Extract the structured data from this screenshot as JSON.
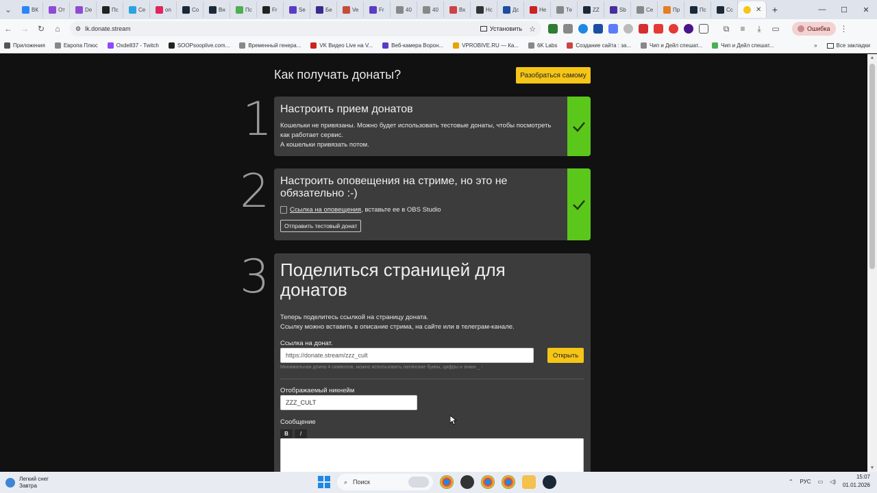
{
  "browser": {
    "tabs": [
      {
        "label": "ВК",
        "color": "#2787f5"
      },
      {
        "label": "От",
        "color": "#8e4bd6"
      },
      {
        "label": "De",
        "color": "#8e4bd6"
      },
      {
        "label": "Пс",
        "color": "#222222"
      },
      {
        "label": "Се",
        "color": "#2aa3df"
      },
      {
        "label": "on",
        "color": "#e0245e"
      },
      {
        "label": "Со",
        "color": "#1b2838"
      },
      {
        "label": "Вн",
        "color": "#1b2838"
      },
      {
        "label": "Пс",
        "color": "#4caf50"
      },
      {
        "label": "Fr",
        "color": "#222222"
      },
      {
        "label": "Se",
        "color": "#5b3cc4"
      },
      {
        "label": "Бе",
        "color": "#3b2b8f"
      },
      {
        "label": "Ve",
        "color": "#c74b3b"
      },
      {
        "label": "Fr",
        "color": "#5b3cc4"
      },
      {
        "label": "40",
        "color": "#888888"
      },
      {
        "label": "40",
        "color": "#888888"
      },
      {
        "label": "Вх",
        "color": "#c44"
      },
      {
        "label": "Нс",
        "color": "#333333"
      },
      {
        "label": "Дс",
        "color": "#1c4ea2"
      },
      {
        "label": "Не",
        "color": "#c22"
      },
      {
        "label": "Те",
        "color": "#888888"
      },
      {
        "label": "ZZ",
        "color": "#1b2838"
      },
      {
        "label": "Sb",
        "color": "#4a2e9e"
      },
      {
        "label": "Се",
        "color": "#888888"
      },
      {
        "label": "Пр",
        "color": "#e67e22"
      },
      {
        "label": "Пс",
        "color": "#1b2838"
      },
      {
        "label": "Сс",
        "color": "#1b2838"
      }
    ],
    "active_tab_color": "#f5c518",
    "url": "lk.donate.stream",
    "install_label": "Установить",
    "error_label": "Ошибка",
    "bookmarks": [
      {
        "label": "Приложения",
        "color": "#555"
      },
      {
        "label": "Европа Плюс",
        "color": "#888"
      },
      {
        "label": "Oxde837 - Twitch",
        "color": "#9146ff"
      },
      {
        "label": "SOOPsooplive.com...",
        "color": "#222"
      },
      {
        "label": "Временный генера...",
        "color": "#888"
      },
      {
        "label": "VK Видео Live на V...",
        "color": "#c22"
      },
      {
        "label": "Веб-камера Ворон...",
        "color": "#5b3cc4"
      },
      {
        "label": "VPROBIVE.RU — Ка...",
        "color": "#e6a400"
      },
      {
        "label": "6K Labs",
        "color": "#888"
      },
      {
        "label": "Создание сайта : за...",
        "color": "#c44"
      },
      {
        "label": "Чип и Дейл спешат...",
        "color": "#888"
      },
      {
        "label": "Чип и Дейл спешат...",
        "color": "#4caf50"
      }
    ],
    "all_bookmarks": "Все закладки"
  },
  "page": {
    "header_title": "Как получать донаты?",
    "header_button": "Разобраться самому",
    "step1": {
      "num": "1",
      "title": "Настроить прием донатов",
      "text1": "Кошельки не привязаны. Можно будет использовать тестовые донаты, чтобы посмотреть как работает сервис.",
      "text2": "А кошельки привязать потом."
    },
    "step2": {
      "num": "2",
      "title": "Настроить оповещения на стриме, но это не обязательно :-)",
      "link_label": "Ссылка на оповещения",
      "link_suffix": ", вставьте ее в OBS Studio",
      "test_button": "Отправить тестовый донат"
    },
    "step3": {
      "num": "3",
      "title": "Поделиться страницей для донатов",
      "text1": "Теперь поделитесь ссылкой на страницу доната.",
      "text2": "Ссылку можно вставить в описание стрима, на сайте или в телеграм-канале.",
      "link_label": "Ссылка на донат.",
      "link_value": "https://donate.stream/zzz_cult",
      "open_button": "Открыть",
      "link_hint": "Минимальная длина 4 символов, можно использовать латинские буквы, цифры и знаки _ -",
      "nick_label": "Отображаемый никнейм",
      "nick_value": "ZZZ_CULT",
      "message_label": "Сообщение",
      "bold": "B",
      "italic": "I"
    }
  },
  "taskbar": {
    "weather_line1": "Легкий снег",
    "weather_line2": "Завтра",
    "search_label": "Поиск",
    "lang": "РУС",
    "time": "15:07",
    "date": "01.01.2026"
  }
}
